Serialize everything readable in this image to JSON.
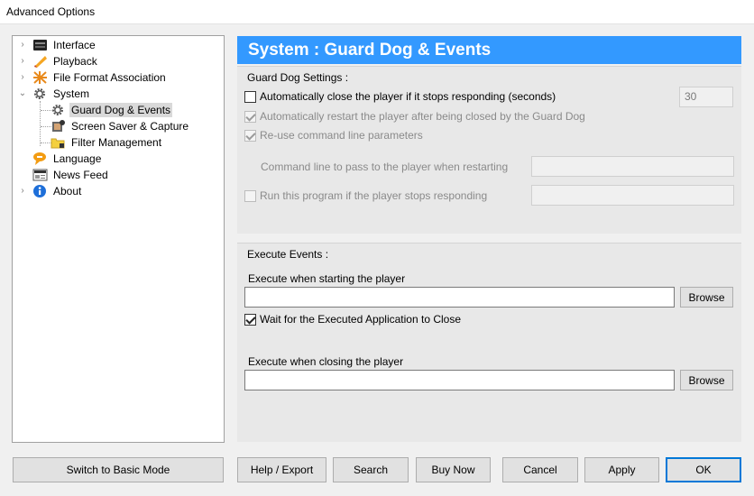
{
  "window": {
    "title": "Advanced Options"
  },
  "tree": {
    "items": [
      {
        "label": "Interface",
        "icon": "interface-icon"
      },
      {
        "label": "Playback",
        "icon": "playback-icon"
      },
      {
        "label": "File Format Association",
        "icon": "file-format-icon"
      },
      {
        "label": "System",
        "icon": "gear-icon",
        "expanded": true
      },
      {
        "label": "Guard Dog & Events",
        "icon": "gear-icon",
        "selected": true
      },
      {
        "label": "Screen Saver & Capture",
        "icon": "screen-capture-icon"
      },
      {
        "label": "Filter Management",
        "icon": "filter-folder-icon"
      },
      {
        "label": "Language",
        "icon": "language-icon"
      },
      {
        "label": "News Feed",
        "icon": "news-icon"
      },
      {
        "label": "About",
        "icon": "info-icon"
      }
    ]
  },
  "header": {
    "title": "System : Guard Dog & Events"
  },
  "guard_dog": {
    "title": "Guard Dog Settings :",
    "auto_close_label": "Automatically close the player if it stops responding (seconds)",
    "auto_close_checked": false,
    "seconds_value": "30",
    "auto_restart_label": "Automatically restart the player after being closed by the Guard Dog",
    "auto_restart_checked": true,
    "reuse_label": "Re-use command line parameters",
    "reuse_checked": true,
    "cmdline_label": "Command line to pass to the player when restarting",
    "cmdline_value": "",
    "run_program_label": "Run this program if the player stops responding",
    "run_program_checked": false,
    "run_program_value": ""
  },
  "execute_events": {
    "title": "Execute Events :",
    "start_label": "Execute when starting the player",
    "start_value": "",
    "browse_label": "Browse",
    "wait_label": "Wait for the Executed Application to Close",
    "wait_checked": true,
    "close_label": "Execute when closing the player",
    "close_value": ""
  },
  "footer": {
    "basic_mode": "Switch to Basic Mode",
    "help_export": "Help / Export",
    "search": "Search",
    "buy_now": "Buy Now",
    "cancel": "Cancel",
    "apply": "Apply",
    "ok": "OK"
  }
}
